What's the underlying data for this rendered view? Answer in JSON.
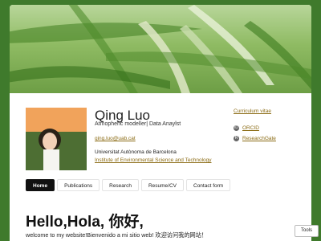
{
  "profile": {
    "name": "Qing Luo",
    "subtitle": "Atmopheric modeller| Data Anaylst",
    "email": "qing.luo@uab.cat",
    "university": "Universitat Autònoma de Barcelona",
    "institute": "Institute of Environmental Science and Technology"
  },
  "links": {
    "cv": "Curriculum vitae",
    "orcid": "ORCID",
    "researchgate": "ResearchGate"
  },
  "nav": {
    "items": [
      "Home",
      "Publications",
      "Research",
      "Resume/CV",
      "Contact form"
    ],
    "active": "Home"
  },
  "content": {
    "heading": "Hello,Hola, 你好,",
    "welcome": "welcome to my website!Bienvenido a mi sitio web! 欢迎访问我的网站！"
  },
  "tools_label": "Tools",
  "colors": {
    "background": "#3f7a2c",
    "link": "#8b6b14",
    "active_nav": "#111111"
  },
  "icons": {
    "orcid": "orcid-icon",
    "researchgate": "researchgate-icon"
  }
}
